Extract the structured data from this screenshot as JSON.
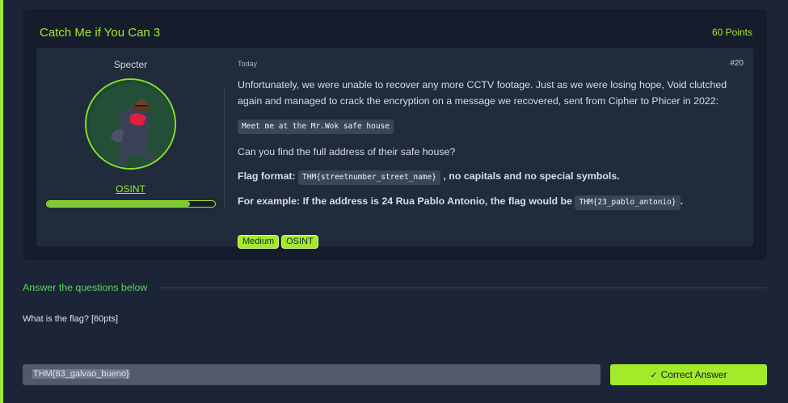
{
  "room": {
    "title": "Catch Me if You Can 3",
    "points": "60 Points"
  },
  "post": {
    "author": "Specter",
    "author_tag": "OSINT",
    "progress_fraction": 0.85,
    "date": "Today",
    "number": "#20",
    "paragraph1": "Unfortunately, we were unable to recover any more CCTV footage. Just as we were losing hope, Void clutched again and managed to crack the encryption on a message we recovered, sent from Cipher to Phicer in 2022:",
    "message_code": "Meet me at the Mr.Wok safe house",
    "question_text": "Can you find the full address of their safe house?",
    "flag_format_label": "Flag format:",
    "flag_format_code": "THM{streetnumber_street_name}",
    "flag_format_suffix": ", no capitals and no special symbols.",
    "example_label": "For example: If the address is 24 Rua Pablo Antonio, the flag would be",
    "example_code": "THM{23_pablo_antonio}",
    "example_suffix": ".",
    "tags": [
      "Medium",
      "OSINT"
    ]
  },
  "answers": {
    "heading": "Answer the questions below",
    "question": "What is the flag? [60pts]",
    "input_value": "THM{83_galvao_bueno}",
    "submit_label": "Correct Answer",
    "submit_icon": "check-icon"
  },
  "colors": {
    "accent": "#a3ea2a",
    "background": "#1c2538",
    "card": "#151c2b",
    "inner_card": "#202b3c"
  }
}
